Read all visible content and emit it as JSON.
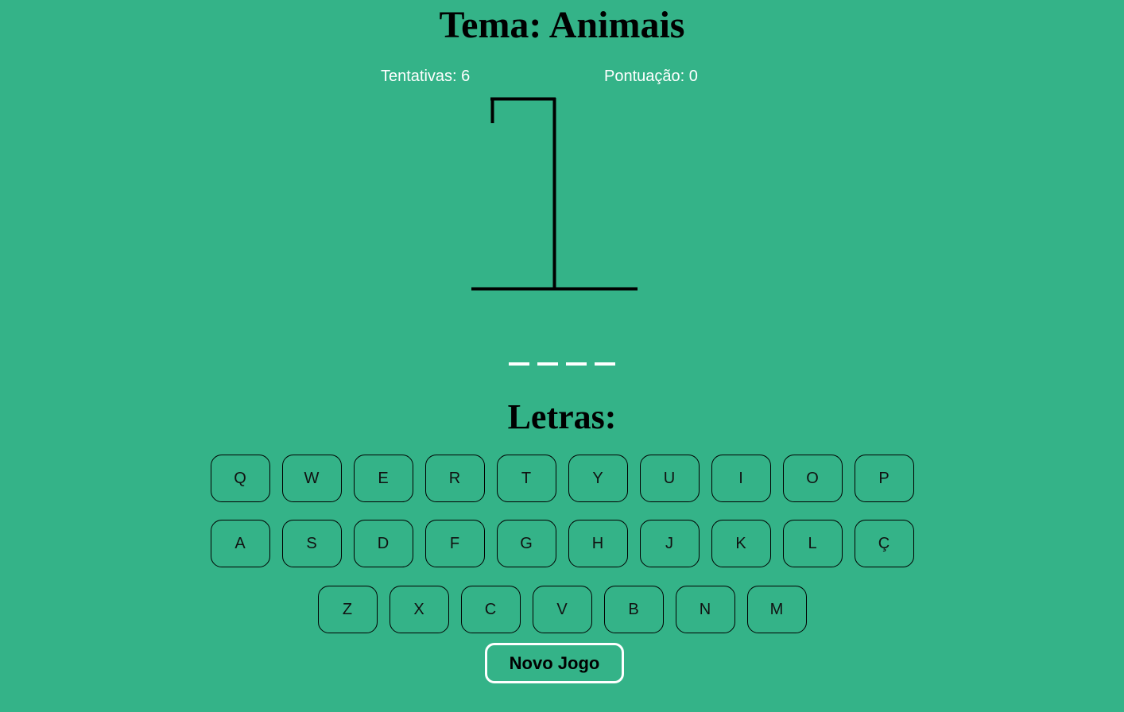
{
  "header": {
    "title": "Tema: Animais"
  },
  "stats": {
    "attempts_label": "Tentativas: 6",
    "score_label": "Pontuação: 0"
  },
  "word": {
    "blanks": [
      "",
      "",
      "",
      ""
    ]
  },
  "keyboard": {
    "heading": "Letras:",
    "rows": [
      [
        "Q",
        "W",
        "E",
        "R",
        "T",
        "Y",
        "U",
        "I",
        "O",
        "P"
      ],
      [
        "A",
        "S",
        "D",
        "F",
        "G",
        "H",
        "J",
        "K",
        "L",
        "Ç"
      ],
      [
        "Z",
        "X",
        "C",
        "V",
        "B",
        "N",
        "M"
      ]
    ]
  },
  "actions": {
    "new_game_label": "Novo Jogo"
  },
  "colors": {
    "background": "#34b388",
    "gallows": "#000000",
    "stat_text": "#ffffff",
    "button_border": "#ffffff"
  }
}
